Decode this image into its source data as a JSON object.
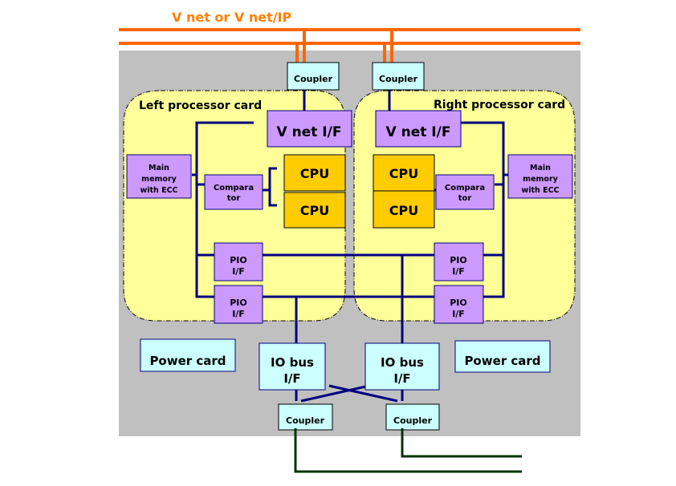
{
  "diagram": {
    "network_label": "V net or V net/IP",
    "colors": {
      "network": "#FF6600",
      "panel": "#C0C0C0",
      "card": "#FFFF99",
      "interface": "#CC99FF",
      "cpu": "#FFCC00",
      "coupler": "#CCFFFF",
      "bus": "#000080",
      "field_cable": "#003300"
    },
    "top_couplers": [
      {
        "label": "Coupler"
      },
      {
        "label": "Coupler"
      }
    ],
    "left_card": {
      "title": "Left processor card",
      "vnet_if": "V net I/F",
      "cpus": [
        "CPU",
        "CPU"
      ],
      "comparator": [
        "Compara",
        "tor"
      ],
      "main_memory": [
        "Main",
        "memory",
        "with ECC"
      ],
      "pio": [
        [
          "PIO",
          "I/F"
        ],
        [
          "PIO",
          "I/F"
        ]
      ]
    },
    "right_card": {
      "title": "Right processor card",
      "vnet_if": "V net I/F",
      "cpus": [
        "CPU",
        "CPU"
      ],
      "comparator": [
        "Compara",
        "tor"
      ],
      "main_memory": [
        "Main",
        "memory",
        "with ECC"
      ],
      "pio": [
        [
          "PIO",
          "I/F"
        ],
        [
          "PIO",
          "I/F"
        ]
      ]
    },
    "power_cards": [
      "Power card",
      "Power card"
    ],
    "io_bus_if": [
      [
        "IO bus",
        "I/F"
      ],
      [
        "IO bus",
        "I/F"
      ]
    ],
    "bottom_couplers": [
      {
        "label": "Coupler"
      },
      {
        "label": "Coupler"
      }
    ]
  }
}
